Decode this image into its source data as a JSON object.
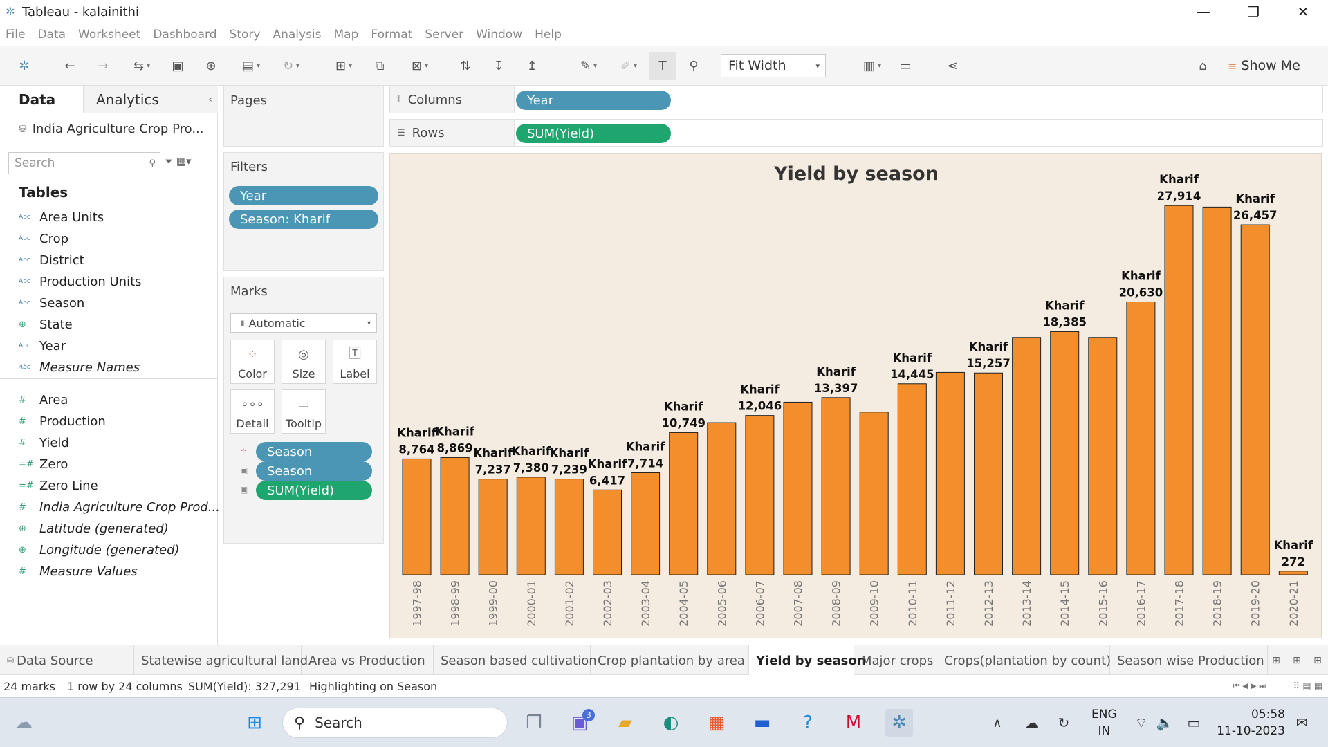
{
  "window": {
    "title": "Tableau - kalainithi"
  },
  "menu": [
    "File",
    "Data",
    "Worksheet",
    "Dashboard",
    "Story",
    "Analysis",
    "Map",
    "Format",
    "Server",
    "Window",
    "Help"
  ],
  "toolbar": {
    "fit": "Fit Width",
    "show_me": "Show Me"
  },
  "left_panel": {
    "tabs": {
      "data": "Data",
      "analytics": "Analytics"
    },
    "datasource": "India Agriculture Crop Pro...",
    "search_placeholder": "Search",
    "tables_heading": "Tables",
    "dimensions": [
      {
        "name": "Area Units",
        "icon": "abc-icon"
      },
      {
        "name": "Crop",
        "icon": "abc-icon"
      },
      {
        "name": "District",
        "icon": "abc-icon"
      },
      {
        "name": "Production Units",
        "icon": "abc-icon"
      },
      {
        "name": "Season",
        "icon": "abc-icon"
      },
      {
        "name": "State",
        "icon": "globe-icon"
      },
      {
        "name": "Year",
        "icon": "abc-icon"
      },
      {
        "name": "Measure Names",
        "icon": "abc-icon"
      }
    ],
    "measures": [
      {
        "name": "Area",
        "icon": "hash-icon"
      },
      {
        "name": "Production",
        "icon": "hash-icon"
      },
      {
        "name": "Yield",
        "icon": "hash-icon"
      },
      {
        "name": "Zero",
        "icon": "calc-hash-icon"
      },
      {
        "name": "Zero Line",
        "icon": "calc-hash-icon"
      },
      {
        "name": "India Agriculture Crop Prod...",
        "icon": "hash-icon"
      },
      {
        "name": "Latitude (generated)",
        "icon": "globe-icon"
      },
      {
        "name": "Longitude (generated)",
        "icon": "globe-icon"
      },
      {
        "name": "Measure Values",
        "icon": "hash-icon"
      }
    ]
  },
  "pages": {
    "heading": "Pages"
  },
  "filters": {
    "heading": "Filters",
    "items": [
      "Year",
      "Season: Kharif"
    ]
  },
  "marks": {
    "heading": "Marks",
    "type": "Automatic",
    "buttons": [
      "Color",
      "Size",
      "Label",
      "Detail",
      "Tooltip"
    ],
    "pills": [
      {
        "label": "Season",
        "icon": "color-dots-icon"
      },
      {
        "label": "Season",
        "icon": "label-text-icon"
      },
      {
        "label": "SUM(Yield)",
        "icon": "label-text-icon"
      }
    ]
  },
  "shelves": {
    "columns_label": "Columns",
    "columns_pill": "Year",
    "rows_label": "Rows",
    "rows_pill": "SUM(Yield)"
  },
  "chart_data": {
    "type": "bar",
    "title": "Yield by season",
    "categories": [
      "1997-98",
      "1998-99",
      "1999-00",
      "2000-01",
      "2001-02",
      "2002-03",
      "2003-04",
      "2004-05",
      "2005-06",
      "2006-07",
      "2007-08",
      "2008-09",
      "2009-10",
      "2010-11",
      "2011-12",
      "2012-13",
      "2013-14",
      "2014-15",
      "2015-16",
      "2016-17",
      "2017-18",
      "2018-19",
      "2019-20",
      "2020-21"
    ],
    "values": [
      8764,
      8869,
      7237,
      7380,
      7239,
      6417,
      7714,
      10749,
      11500,
      12046,
      13050,
      13397,
      12300,
      14445,
      15300,
      15257,
      17950,
      18385,
      17950,
      20630,
      27914,
      27800,
      26457,
      272
    ],
    "labels": [
      "8,764",
      "8,869",
      "7,237",
      "7,380",
      "7,239",
      "6,417",
      "7,714",
      "10,749",
      "",
      "12,046",
      "",
      "13,397",
      "",
      "14,445",
      "",
      "15,257",
      "",
      "18,385",
      "",
      "20,630",
      "27,914",
      "",
      "26,457",
      "272"
    ],
    "label_prefix": "Kharif",
    "bar_color": "#f28e2b",
    "ylim": [
      0,
      28500
    ]
  },
  "sheet_tabs": {
    "datasource": "Data Source",
    "tabs": [
      "Statewise agricultural land",
      "Area vs Production",
      "Season based cultivation",
      "Crop plantation by area",
      "Yield by season",
      "Major crops",
      "Crops(plantation by count)",
      "Season wise Production"
    ],
    "active": "Yield by season"
  },
  "status": {
    "marks": "24 marks",
    "dims": "1 row by 24 columns",
    "sum": "SUM(Yield): 327,291",
    "highlight": "Highlighting on Season"
  },
  "taskbar": {
    "search": "Search",
    "lang1": "ENG",
    "lang2": "IN",
    "time": "05:58",
    "date": "11-10-2023",
    "chat_badge": "3"
  }
}
